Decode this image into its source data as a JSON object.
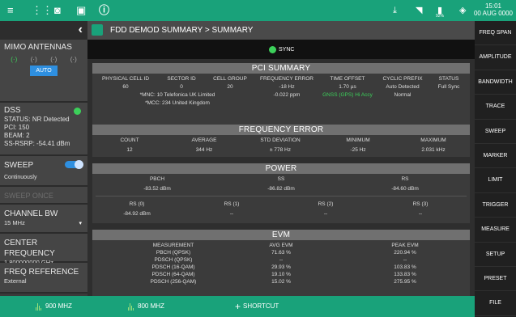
{
  "status_bar": {
    "time": "15:01",
    "date": "00 AUG 0000",
    "battery": "92%"
  },
  "left_panel": {
    "mimo": {
      "title": "MIMO ANTENNAS",
      "antennas": [
        "(·)",
        "(·)",
        "(·)",
        "(·)"
      ],
      "auto": "AUTO"
    },
    "dss": {
      "title": "DSS",
      "status": "STATUS: NR Detected",
      "pci": "PCI: 150",
      "beam": "BEAM: 2",
      "ssrsrp": "SS-RSRP: -54.41 dBm"
    },
    "sweep": {
      "title": "SWEEP",
      "value": "Continuously"
    },
    "sweep_once": "SWEEP ONCE",
    "channel_bw": {
      "title": "CHANNEL BW",
      "value": "15 MHz"
    },
    "center_freq": {
      "title": "CENTER FREQUENCY",
      "value": "1.800000000 GHz"
    },
    "freq_ref": {
      "title": "FREQ REFERENCE",
      "value": "External"
    }
  },
  "header": {
    "title": "FDD DEMOD SUMMARY  >  SUMMARY"
  },
  "sync": "SYNC",
  "pci_summary": {
    "title": "PCI SUMMARY",
    "headers": [
      "PHYSICAL CELL ID",
      "SECTOR ID",
      "CELL GROUP",
      "FREQUENCY ERROR",
      "TIME OFFSET",
      "CYCLIC PREFIX",
      "STATUS"
    ],
    "values": [
      "60",
      "0",
      "20",
      "-18 Hz",
      "1.70 µs",
      "Auto Detected",
      "Full Sync"
    ],
    "mnc": "*MNC: 10 Telefonica UK Limited",
    "mcc": "*MCC: 234 United Kingdom",
    "ppm": "-0.022 ppm",
    "gnss": "GNSS (GPS) Hi Accy",
    "cp_type": "Normal"
  },
  "frequency_error": {
    "title": "FREQUENCY ERROR",
    "headers": [
      "COUNT",
      "AVERAGE",
      "STD DEVIATION",
      "MINIMUM",
      "MAXIMUM"
    ],
    "values": [
      "12",
      "344 Hz",
      "± 778 Hz",
      "-25 Hz",
      "2.031 kHz"
    ]
  },
  "power": {
    "title": "POWER",
    "headers": [
      "PBCH",
      "SS",
      "RS"
    ],
    "values": [
      "-83.52 dBm",
      "-86.82 dBm",
      "-84.60 dBm"
    ],
    "rs_headers": [
      "RS (0)",
      "RS (1)",
      "RS (2)",
      "RS (3)"
    ],
    "rs_values": [
      "-84.92 dBm",
      "--",
      "--",
      "--"
    ]
  },
  "evm": {
    "title": "EVM",
    "headers": [
      "MEASUREMENT",
      "AVG EVM",
      "PEAK EVM"
    ],
    "rows": [
      {
        "m": "PBCH (QPSK)",
        "avg": "71.63 %",
        "peak": "220.94 %"
      },
      {
        "m": "PDSCH (QPSK)",
        "avg": "--",
        "peak": "--"
      },
      {
        "m": "PDSCH (16-QAM)",
        "avg": "29.93 %",
        "peak": "103.83 %"
      },
      {
        "m": "PDSCH (64-QAM)",
        "avg": "19.10 %",
        "peak": "133.83 %"
      },
      {
        "m": "PDSCH (256-QAM)",
        "avg": "15.02 %",
        "peak": "275.95 %"
      }
    ]
  },
  "right_menu": [
    "FREQ SPAN",
    "AMPLITUDE",
    "BANDWIDTH",
    "TRACE",
    "SWEEP",
    "MARKER",
    "LIMIT",
    "TRIGGER",
    "MEASURE",
    "SETUP",
    "PRESET",
    "FILE"
  ],
  "bottom": {
    "tab1": "900 MHZ",
    "tab2": "800 MHZ",
    "shortcut": "SHORTCUT"
  }
}
